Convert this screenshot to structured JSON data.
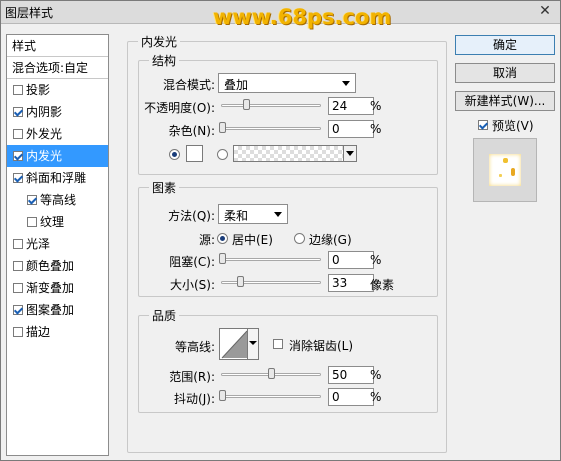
{
  "window": {
    "title": "图层样式",
    "close_glyph": "✕"
  },
  "watermark": "www.68ps.com",
  "sidebar": {
    "header": "样式",
    "items": [
      {
        "label": "混合选项:自定",
        "checkbox": false,
        "checked": false,
        "indent": false,
        "selected": false
      },
      {
        "label": "投影",
        "checkbox": true,
        "checked": false,
        "indent": false,
        "selected": false
      },
      {
        "label": "内阴影",
        "checkbox": true,
        "checked": true,
        "indent": false,
        "selected": false
      },
      {
        "label": "外发光",
        "checkbox": true,
        "checked": false,
        "indent": false,
        "selected": false
      },
      {
        "label": "内发光",
        "checkbox": true,
        "checked": true,
        "indent": false,
        "selected": true
      },
      {
        "label": "斜面和浮雕",
        "checkbox": true,
        "checked": true,
        "indent": false,
        "selected": false
      },
      {
        "label": "等高线",
        "checkbox": true,
        "checked": true,
        "indent": true,
        "selected": false
      },
      {
        "label": "纹理",
        "checkbox": true,
        "checked": false,
        "indent": true,
        "selected": false
      },
      {
        "label": "光泽",
        "checkbox": true,
        "checked": false,
        "indent": false,
        "selected": false
      },
      {
        "label": "颜色叠加",
        "checkbox": true,
        "checked": false,
        "indent": false,
        "selected": false
      },
      {
        "label": "渐变叠加",
        "checkbox": true,
        "checked": false,
        "indent": false,
        "selected": false
      },
      {
        "label": "图案叠加",
        "checkbox": true,
        "checked": true,
        "indent": false,
        "selected": false
      },
      {
        "label": "描边",
        "checkbox": true,
        "checked": false,
        "indent": false,
        "selected": false
      }
    ]
  },
  "inner_glow": {
    "title": "内发光",
    "structure": {
      "title": "结构",
      "blend_mode_label": "混合模式:",
      "blend_mode_value": "叠加",
      "opacity_label": "不透明度(O):",
      "opacity_value": "24",
      "opacity_unit": "%",
      "opacity": 0.24,
      "noise_label": "杂色(N):",
      "noise_value": "0",
      "noise_unit": "%",
      "noise": 0
    },
    "elements": {
      "title": "图素",
      "technique_label": "方法(Q):",
      "technique_value": "柔和",
      "source_label": "源:",
      "source_center": "居中(E)",
      "source_edge": "边缘(G)",
      "choke_label": "阻塞(C):",
      "choke_value": "0",
      "choke_unit": "%",
      "choke": 0,
      "size_label": "大小(S):",
      "size_value": "33",
      "size_unit": "像素",
      "size": 33
    },
    "quality": {
      "title": "品质",
      "contour_label": "等高线:",
      "antialias_label": "消除锯齿(L)",
      "range_label": "范围(R):",
      "range_value": "50",
      "range_unit": "%",
      "range": 0.5,
      "jitter_label": "抖动(J):",
      "jitter_value": "0",
      "jitter_unit": "%",
      "jitter": 0
    }
  },
  "buttons": {
    "ok": "确定",
    "cancel": "取消",
    "new_style": "新建样式(W)...",
    "preview": "预览(V)"
  }
}
